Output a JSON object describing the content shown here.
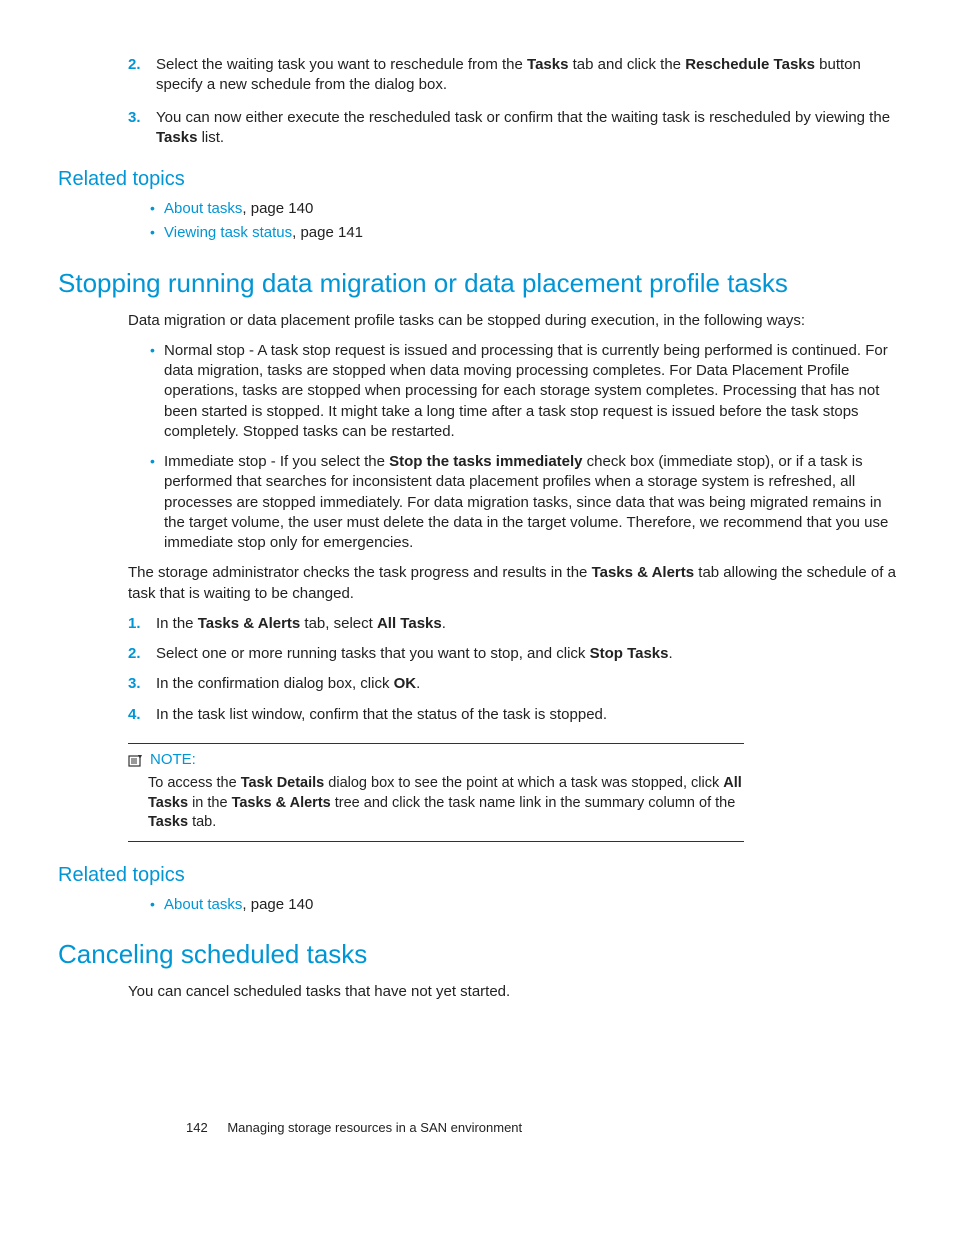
{
  "top_steps": [
    {
      "n": "2.",
      "pre": "Select the waiting task you want to reschedule from the ",
      "b1": "Tasks",
      "mid": " tab and click the ",
      "b2": "Reschedule Tasks",
      "post": " button specify a new schedule from the dialog box."
    },
    {
      "n": "3.",
      "pre": "You can now either execute the rescheduled task or confirm that the waiting task is rescheduled by viewing the ",
      "b1": "Tasks",
      "post": " list."
    }
  ],
  "rt1_heading": "Related topics",
  "rt1": [
    {
      "link": "About tasks",
      "rest": ", page 140"
    },
    {
      "link": "Viewing task status",
      "rest": ", page 141"
    }
  ],
  "h2a": "Stopping running data migration or data placement profile tasks",
  "p1": "Data migration or data placement profile tasks can be stopped during execution, in the following ways:",
  "ways": [
    "Normal stop - A task stop request is issued and processing that is currently being performed is continued. For data migration, tasks are stopped when data moving processing completes. For Data Placement Profile operations, tasks are stopped when processing for each storage system completes. Processing that has not been started is stopped. It might take a long time after a task stop request is issued before the task stops completely. Stopped tasks can be restarted.",
    {
      "pre": "Immediate stop - If you select the ",
      "b": "Stop the tasks immediately",
      "post": " check box (immediate stop), or if a task is performed that searches for inconsistent data placement profiles when a storage system is refreshed, all processes are stopped immediately. For data migration tasks, since data that was being migrated remains in the target volume, the user must delete the data in the target volume. Therefore, we recommend that you use immediate stop only for emergencies."
    }
  ],
  "p2": {
    "pre": "The storage administrator checks the task progress and results in the ",
    "b": "Tasks & Alerts",
    "post": " tab allowing the schedule of a task that is waiting to be changed."
  },
  "steps": [
    {
      "n": "1.",
      "pre": "In the ",
      "b1": "Tasks & Alerts",
      "mid": " tab, select ",
      "b2": "All Tasks",
      "post": "."
    },
    {
      "n": "2.",
      "pre": "Select one or more running tasks that you want to stop, and click ",
      "b1": "Stop Tasks",
      "post": "."
    },
    {
      "n": "3.",
      "pre": "In the confirmation dialog box, click ",
      "b1": "OK",
      "post": "."
    },
    {
      "n": "4.",
      "pre": "In the task list window, confirm that the status of the task is stopped.",
      "b1": "",
      "post": ""
    }
  ],
  "note_label": "NOTE:",
  "note": {
    "pre": "To access the ",
    "b1": "Task Details",
    "mid1": " dialog box to see the point at which a task was stopped, click ",
    "b2": "All Tasks",
    "mid2": " in the ",
    "b3": "Tasks & Alerts",
    "mid3": " tree and click the task name link in the summary column of the ",
    "b4": "Tasks",
    "post": " tab."
  },
  "rt2_heading": "Related topics",
  "rt2": [
    {
      "link": "About tasks",
      "rest": ", page 140"
    }
  ],
  "h2b": "Canceling scheduled tasks",
  "p3": "You can cancel scheduled tasks that have not yet started.",
  "footer_page": "142",
  "footer_title": "Managing storage resources in a SAN environment"
}
